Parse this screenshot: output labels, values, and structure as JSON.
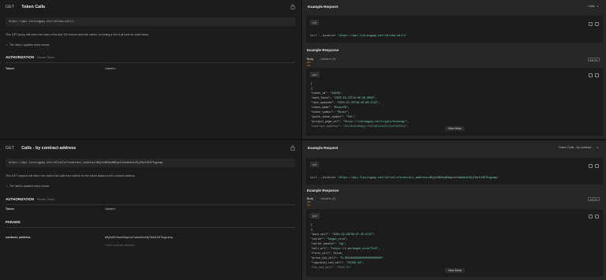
{
  "colors": {
    "string": "#7fd0c0",
    "status_code": "#e0893a"
  },
  "icons": [
    "lock-icon",
    "copy-icon",
    "expand-icon",
    "chevron-down-icon"
  ],
  "sections": [
    {
      "method": "GET",
      "title": "Token Calls",
      "url": "https://api.listingpay.net/v3/new-calls",
      "description": "This GET query will return the data of the last 100 tokens from the callers, including a list of all calls for each token.",
      "bullet": "The data is updated every minute.",
      "auth_heading": "AUTHORIZATION",
      "auth_type": "Bearer Token",
      "token_label": "Token",
      "token_value": "<token>",
      "example_request_title": "Example Request",
      "example_dropdown": "Calls",
      "code_lang": "curl",
      "curl_cmd": "curl --location ",
      "curl_url": "'https://api.listingpay.net/v3/new-calls'",
      "response_heading": "Example Response",
      "tab_body": "Body",
      "tab_body_note": "200 OK",
      "tab_headers": "Headers (9)",
      "status_chip": "200 OK",
      "json_pill": "json",
      "json_lines": [
        "[",
        "  {",
        "    \"token_id\": \"49938\",",
        "    \"date_found\": \"2025-03-25T16:09:38.680Z\",",
        "    \"last_updated\": \"2025-03-25T18:40:06.371Z\",",
        "    \"token_name\": \"BrazzOG\",",
        "    \"token_symbol\": \"Brazz\",",
        "    \"quote_token_symbol\": \"SOL\",",
        "    \"project_page_url\": \"https://listingpay.net/crypto/brazzog/\",",
        "    \"contract_address\": \"9XcnEbGsmN8gyrFSdCa6b3nkW3jC8afVhX6Tkn\","
      ],
      "view_more": "View More"
    },
    {
      "method": "GET",
      "title": "Calls - by contract address",
      "url": "https://api.listingpay.net/v3/calls?contract_address=89jAvBG4umB6qz1zCada3nk43jC8af4X6Tkqpump",
      "description": "This GET request will return the data of all calls from callers for the token based on its contract address.",
      "bullet": "The data is updated every minute.",
      "auth_heading": "AUTHORIZATION",
      "auth_type": "Bearer Token",
      "token_label": "Token",
      "token_value": "<token>",
      "params_heading": "PARAMS",
      "param_key": "contract_address",
      "param_value": "89jAvBG4umB6qz1zCada3nk43jC8af4X6Tkqpump",
      "param_placeholder": "Token contract address",
      "example_request_title": "Example Request",
      "example_dropdown": "Token Calls - by contract ...",
      "code_lang": "curl",
      "curl_cmd": "curl --location ",
      "curl_url": "'https://api.listingpay.net/v3/calls?contract_address=89jAvBG4umB6qz1zCada3nk43jC8af4X6Tkqpump'",
      "response_heading": "Example Response",
      "tab_body": "Body",
      "tab_body_note": "200 OK",
      "tab_headers": "Headers (9)",
      "status_chip": "200 OK",
      "json_pill": "json",
      "json_lines": [
        "[",
        "  {",
        "    \"date_call\": \"2025-03-26T08:37:35.871Z\",",
        "    \"caller\": \"Degen_xtrm\",",
        "    \"caller_handle\": \"dg\",",
        "    \"call_url\": \"https://t.me/degen_xtrm/7512\",",
        "    \"first_call\": false,",
        "    \"price_usd_call\": \"0.00160600000000000000000\",",
        "    \"liquidity_usd_call\": \"25309.34\",",
        "    \"fdv_usd_call\": \"1545.04\""
      ],
      "view_more": "View More"
    }
  ]
}
